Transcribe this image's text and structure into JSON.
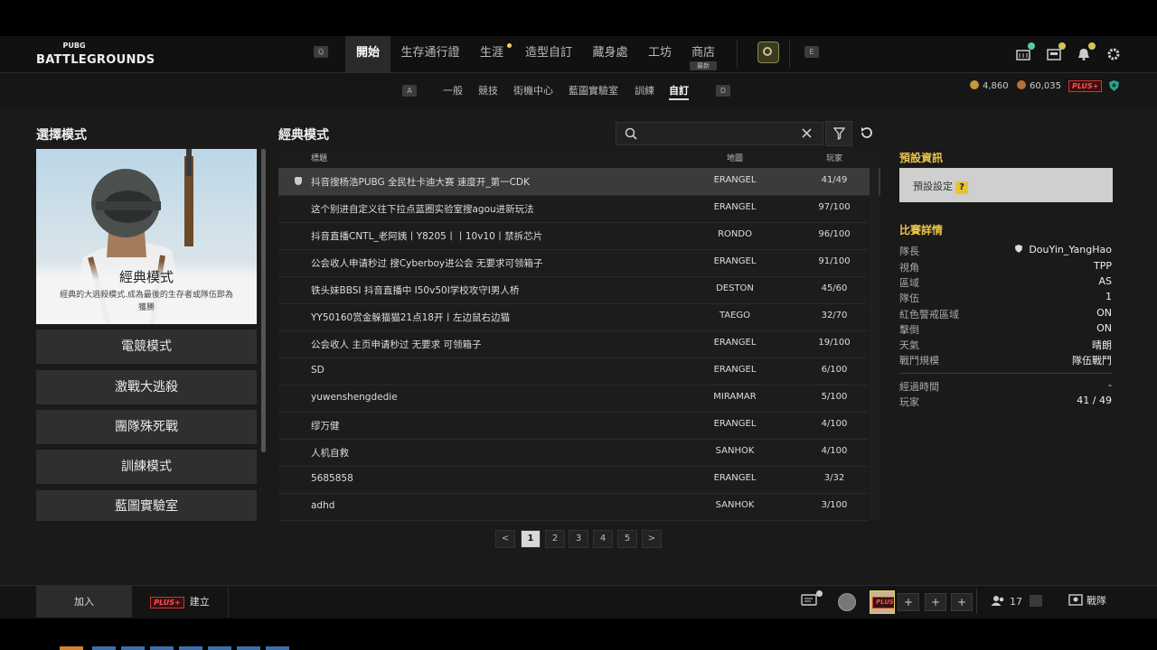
{
  "app": {
    "logo_small": "PUBG",
    "logo_big": "BATTLEGROUNDS"
  },
  "nav": {
    "key_left": "Q",
    "key_right": "E",
    "tabs": [
      {
        "label": "開始"
      },
      {
        "label": "生存通行證"
      },
      {
        "label": "生涯"
      },
      {
        "label": "造型自訂"
      },
      {
        "label": "藏身處"
      },
      {
        "label": "工坊"
      },
      {
        "label": "商店"
      }
    ],
    "store_new_tag": "最新"
  },
  "subnav": {
    "key_left": "A",
    "key_right": "D",
    "tabs": [
      {
        "label": "一般"
      },
      {
        "label": "競技"
      },
      {
        "label": "街機中心"
      },
      {
        "label": "藍圖實驗室"
      },
      {
        "label": "訓練"
      },
      {
        "label": "自訂"
      }
    ]
  },
  "currency": {
    "gcoin": "4,860",
    "bp": "60,035",
    "plus": "PLUS+"
  },
  "left": {
    "title": "選擇模式",
    "card_title": "經典模式",
    "card_desc": "經典的大逃殺模式.成為最後的生存者或隊伍即為獲勝",
    "modes": [
      {
        "label": "電競模式"
      },
      {
        "label": "激戰大逃殺"
      },
      {
        "label": "團隊殊死戰"
      },
      {
        "label": "訓練模式"
      },
      {
        "label": "藍圖實驗室"
      }
    ]
  },
  "center": {
    "title": "經典模式",
    "search_value": "",
    "columns": {
      "title": "標題",
      "map": "地圖",
      "players": "玩家"
    },
    "rows": [
      {
        "title": "抖音搜杨浩PUBG 全民杜卡迪大赛 速度开_第一CDK",
        "map": "ERANGEL",
        "players": "41/49"
      },
      {
        "title": "这个别进自定义往下拉点蓝圈实验室搜agou进新玩法",
        "map": "ERANGEL",
        "players": "97/100"
      },
      {
        "title": "抖音直播CNTL_老阿姨丨Y8205丨丨10v10丨禁拆芯片",
        "map": "RONDO",
        "players": "96/100"
      },
      {
        "title": "公会收人申请秒过 搜Cyberboy进公会 无要求可领箱子",
        "map": "ERANGEL",
        "players": "91/100"
      },
      {
        "title": "铁头妹BBSI 抖音直播中 I50v50I学校攻守I男人桥",
        "map": "DESTON",
        "players": "45/60"
      },
      {
        "title": "YY50160赏金躲猫猫21点18开丨左边鼠右边猫",
        "map": "TAEGO",
        "players": "32/70"
      },
      {
        "title": "公会收人 主页申请秒过 无要求 可领箱子",
        "map": "ERANGEL",
        "players": "19/100"
      },
      {
        "title": "SD",
        "map": "ERANGEL",
        "players": "6/100"
      },
      {
        "title": "yuwenshengdedie",
        "map": "MIRAMAR",
        "players": "5/100"
      },
      {
        "title": "缪万健",
        "map": "ERANGEL",
        "players": "4/100"
      },
      {
        "title": "人机自救",
        "map": "SANHOK",
        "players": "4/100"
      },
      {
        "title": "5685858",
        "map": "ERANGEL",
        "players": "3/32"
      },
      {
        "title": "adhd",
        "map": "SANHOK",
        "players": "3/100"
      }
    ],
    "pages": [
      "1",
      "2",
      "3",
      "4",
      "5"
    ],
    "prev": "<",
    "next": ">"
  },
  "right": {
    "preset_title": "預設資訊",
    "preset_value": "預設設定",
    "preset_help": "?",
    "details_title": "比賽詳情",
    "details": [
      {
        "label": "隊長",
        "value": "DouYin_YangHao"
      },
      {
        "label": "視角",
        "value": "TPP"
      },
      {
        "label": "區域",
        "value": "AS"
      },
      {
        "label": "隊伍",
        "value": "1"
      },
      {
        "label": "紅色警戒區域",
        "value": "ON"
      },
      {
        "label": "擊倒",
        "value": "ON"
      },
      {
        "label": "天氣",
        "value": "晴朗"
      },
      {
        "label": "戰鬥規模",
        "value": "隊伍戰鬥"
      }
    ],
    "extra": [
      {
        "label": "經過時間",
        "value": "-"
      },
      {
        "label": "玩家",
        "value": "41 / 49"
      }
    ]
  },
  "bottom": {
    "join": "加入",
    "create_badge": "PLUS+",
    "create": "建立",
    "plus": "+",
    "friends_count": "17",
    "party": "戰隊",
    "avatar_tag": "PLUS"
  },
  "colors": {
    "accent_yellow": "#e9c44a",
    "plus_red": "#ff5050"
  }
}
